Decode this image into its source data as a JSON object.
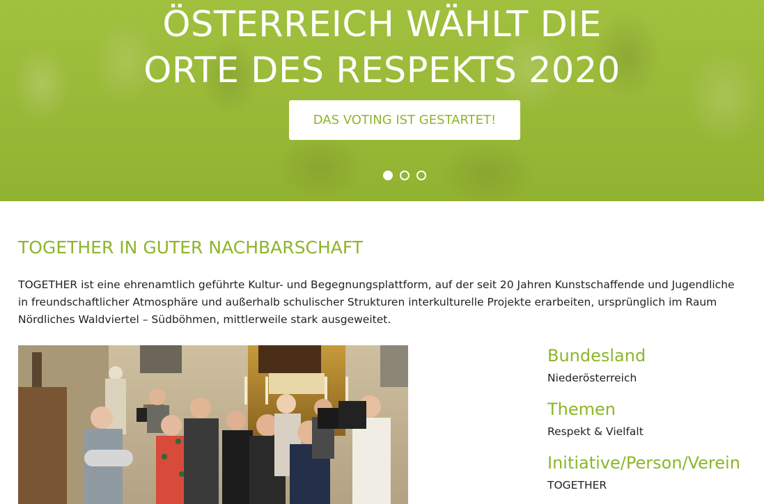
{
  "hero": {
    "title_line1": "ÖSTERREICH WÄHLT DIE",
    "title_line2": "ORTE DES RESPEKTS 2020",
    "cta_label": "DAS VOTING IST GESTARTET!",
    "slide_count": 3,
    "active_slide": 1,
    "background_color": "#9bbd34"
  },
  "article": {
    "title": "TOGETHER IN GUTER NACHBARSCHAFT",
    "description": "TOGETHER ist eine ehrenamtlich geführte Kultur- und Begegnungsplattform, auf der seit 20 Jahren Kunstschaffende und Jugendliche in freundschaftlicher Atmosphäre und außerhalb schulischer Strukturen interkulturelle Projekte erarbeiten, ursprünglich im Raum Nördliches Waldviertel – Südböhmen, mittlerweile stark ausgeweitet.",
    "accent_color": "#8db52a"
  },
  "meta": {
    "state_heading": "Bundesland",
    "state_value": "Niederösterreich",
    "topics_heading": "Themen",
    "topics_value": "Respekt & Vielfalt",
    "initiative_heading": "Initiative/Person/Verein",
    "initiative_value": "TOGETHER"
  }
}
